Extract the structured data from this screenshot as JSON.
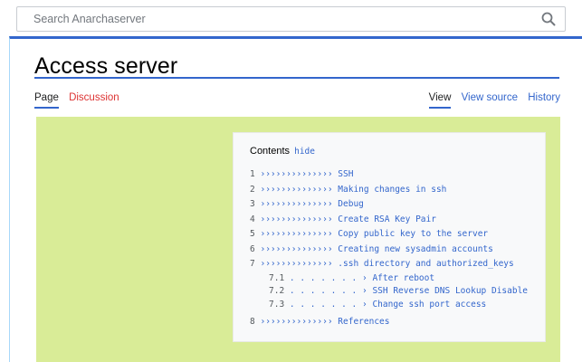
{
  "search": {
    "placeholder": "Search Anarchaserver",
    "icon": "search-icon"
  },
  "page": {
    "title": "Access server"
  },
  "tabs": {
    "left": [
      {
        "label": "Page",
        "active": true
      },
      {
        "label": "Discussion",
        "active": false
      }
    ],
    "right": [
      {
        "label": "View",
        "active": true
      },
      {
        "label": "View source",
        "active": false
      },
      {
        "label": "History",
        "active": false
      }
    ]
  },
  "toc": {
    "heading": "Contents",
    "hide_label": "hide",
    "items": [
      {
        "num": "1",
        "dots": "››››››››››››››",
        "text": "SSH"
      },
      {
        "num": "2",
        "dots": "››››››››››››››",
        "text": "Making changes in ssh"
      },
      {
        "num": "3",
        "dots": "››››››››››››››",
        "text": "Debug"
      },
      {
        "num": "4",
        "dots": "››››››››››››››",
        "text": "Create RSA Key Pair"
      },
      {
        "num": "5",
        "dots": "››››››››››››››",
        "text": "Copy public key to the server"
      },
      {
        "num": "6",
        "dots": "››››››››››››››",
        "text": "Creating new sysadmin accounts"
      },
      {
        "num": "7",
        "dots": "››››››››››››››",
        "text": ".ssh directory and authorized_keys"
      }
    ],
    "subitems": [
      {
        "num": "7.1",
        "dots": ". . . . . . . ›",
        "text": "After reboot"
      },
      {
        "num": "7.2",
        "dots": ". . . . . . . ›",
        "text": "SSH Reverse DNS Lookup Disable"
      },
      {
        "num": "7.3",
        "dots": ". . . . . . . ›",
        "text": "Change ssh port access"
      }
    ],
    "last": {
      "num": "8",
      "dots": "››››››››››››››",
      "text": "References"
    }
  },
  "colors": {
    "accent": "#3366cc",
    "link": "#3366cc",
    "red_link": "#dd3333",
    "content_bg": "#d9ec97",
    "toc_bg": "#f8f9fa"
  }
}
